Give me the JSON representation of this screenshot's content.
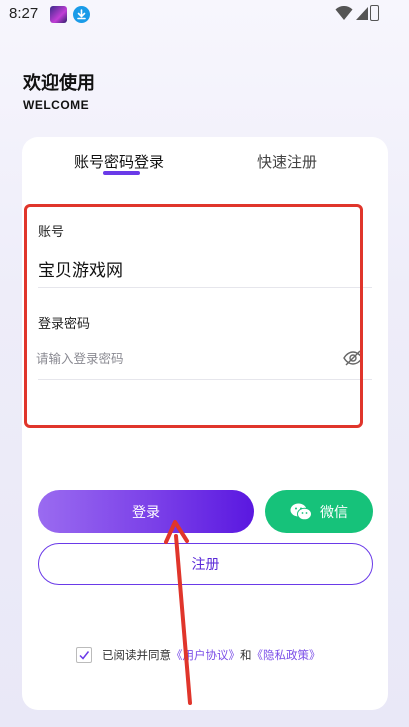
{
  "status_bar": {
    "time": "8:27",
    "icons": [
      "app-icon",
      "download-icon",
      "wifi-icon",
      "signal-icon",
      "battery-icon"
    ]
  },
  "header": {
    "title": "欢迎使用",
    "subtitle": "WELCOME"
  },
  "tabs": [
    {
      "label": "账号密码登录",
      "active": true
    },
    {
      "label": "快速注册",
      "active": false
    }
  ],
  "account": {
    "label": "账号",
    "value": "宝贝游戏网"
  },
  "password": {
    "label": "登录密码",
    "placeholder": "请输入登录密码"
  },
  "buttons": {
    "login": "登录",
    "wechat": "微信",
    "register": "注册"
  },
  "agreement": {
    "prefix": "已阅读并同意",
    "terms": "《用户协议》",
    "and": "和",
    "privacy": "《隐私政策》",
    "checked": true
  },
  "colors": {
    "accent": "#6a3ae8",
    "wechat": "#16c27a",
    "highlight": "#e0352b"
  }
}
